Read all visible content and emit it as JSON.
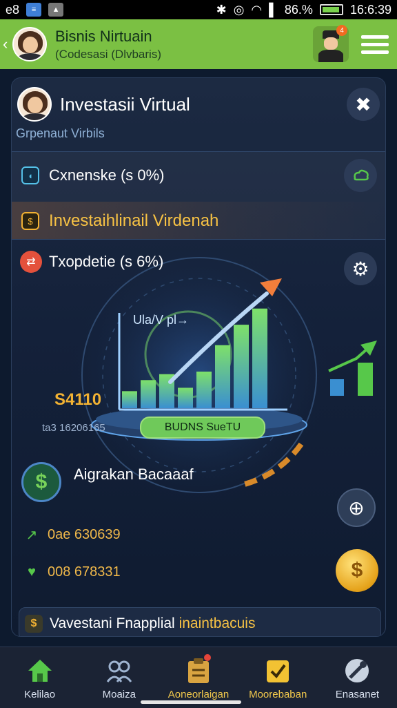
{
  "status_bar": {
    "left_text": "e8",
    "time": "16:6:39",
    "battery": "86.%"
  },
  "app_bar": {
    "title": "Bisnis Nirtuain",
    "subtitle": "(Codesasi (Dlvbaris)",
    "agent_badge": "4"
  },
  "panel": {
    "title": "Investasii Virtual",
    "subtitle": "Grpenaut Virbils",
    "close_icon": "close-icon"
  },
  "card1": {
    "row1_label": "Cxnenske (s 0%)",
    "row2_label": "Investaihlinail Virdenah"
  },
  "card2": {
    "row_label": "Txopdetie (s 6%)",
    "chart_axis_label": "Ula/V pl→",
    "amount": "S4110",
    "reference": "ta3 16206165",
    "chart_caption": "BUDNS SueTU"
  },
  "chart_data": {
    "type": "bar",
    "categories": [
      "1",
      "2",
      "3",
      "4",
      "5",
      "6",
      "7",
      "8"
    ],
    "values": [
      2,
      3.3,
      4,
      2.4,
      4.3,
      7.4,
      9.8,
      11.7
    ],
    "title": "",
    "xlabel": "",
    "ylabel": "Ula/V pl→",
    "trend": "up",
    "colors": {
      "bar_low": "#5bcc5a",
      "bar_high": "#3a8fd1",
      "arrow": "#f27e3b"
    }
  },
  "section": {
    "title": "Aigrakan Bacaaaf",
    "value1": "0ae 630639",
    "value2": "008 678331"
  },
  "footer": {
    "text_main": "Vavestani Fnapplial ",
    "text_highlight": "inaintbacuis"
  },
  "bottom_nav": [
    {
      "label": "Kelilao",
      "icon": "home-icon"
    },
    {
      "label": "Moaiza",
      "icon": "people-icon"
    },
    {
      "label": "Aoneorlaigan",
      "icon": "clipboard-icon"
    },
    {
      "label": "Moorebaban",
      "icon": "checklist-icon"
    },
    {
      "label": "Enasanet",
      "icon": "tools-icon"
    }
  ]
}
